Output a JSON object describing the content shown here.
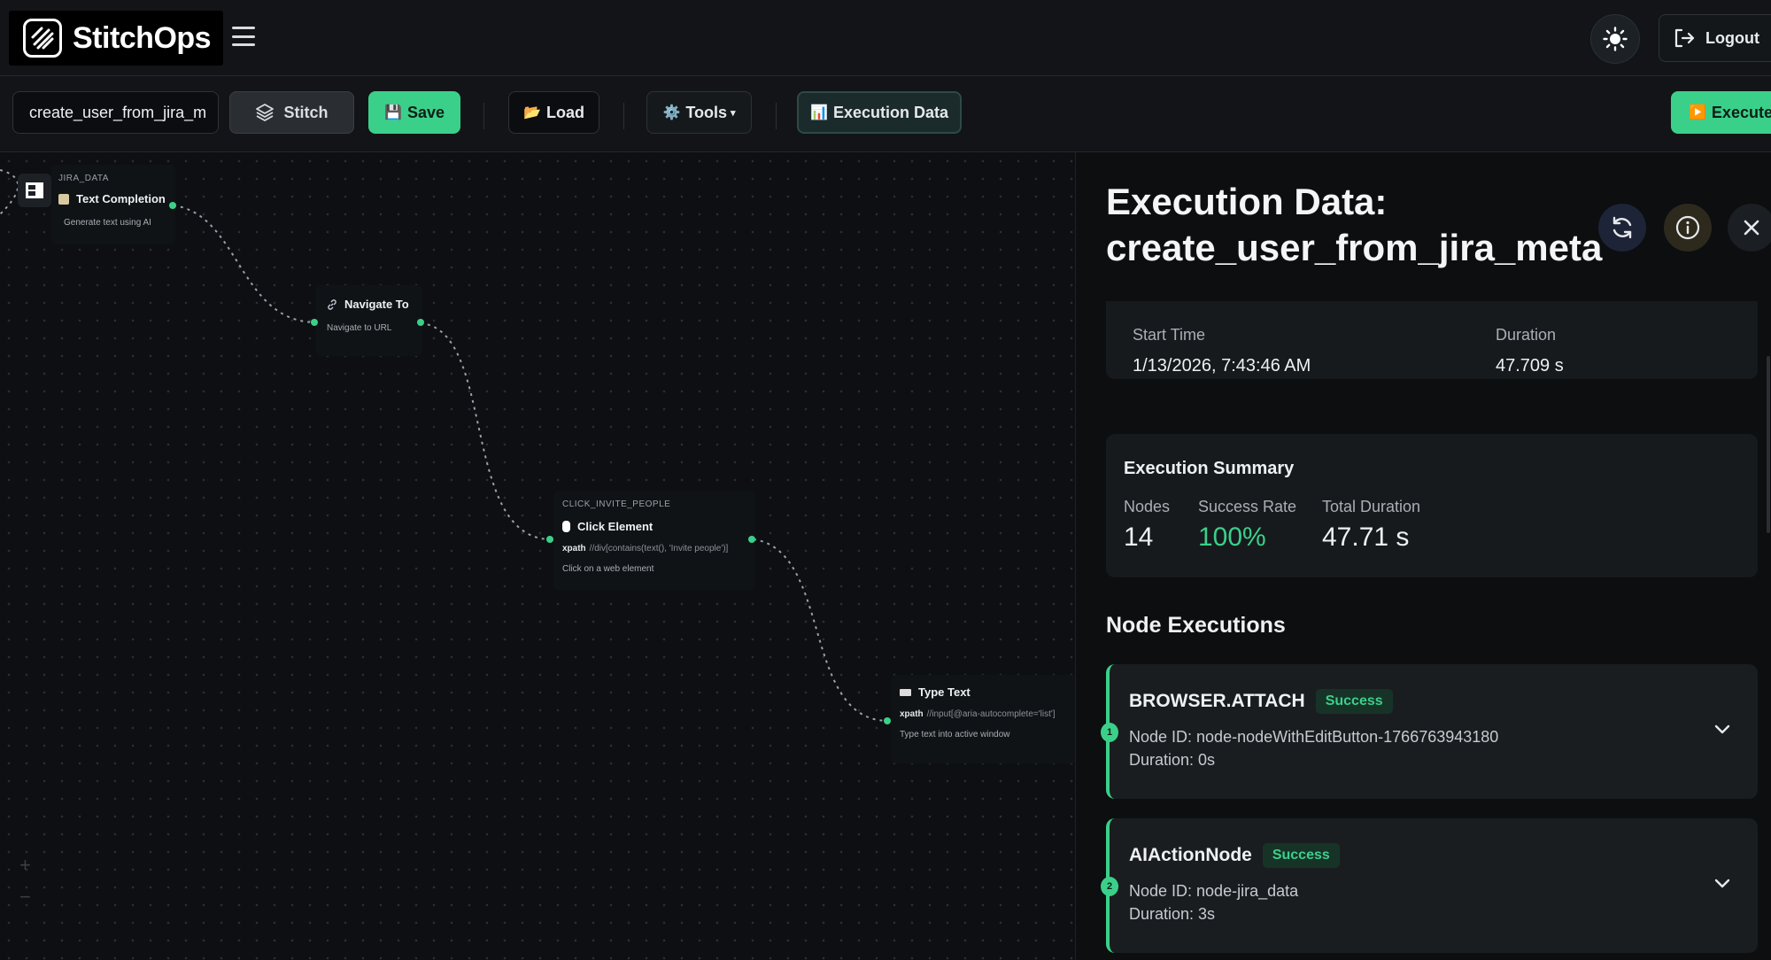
{
  "header": {
    "brand": "StitchOps",
    "logout_label": "Logout"
  },
  "toolbar": {
    "workflow_name": "create_user_from_jira_m",
    "stitch_label": "Stitch",
    "save_label": "Save",
    "load_label": "Load",
    "tools_label": "Tools",
    "execution_data_label": "Execution Data",
    "execute_label": "Execute"
  },
  "canvas": {
    "nodes": [
      {
        "tag": "JIRA_DATA",
        "title": "Text Completion",
        "subtitle": "Generate text using AI"
      },
      {
        "title": "Navigate To",
        "subtitle": "Navigate to URL"
      },
      {
        "tag": "CLICK_INVITE_PEOPLE",
        "title": "Click Element",
        "prop_key": "xpath",
        "prop_val": "//div[contains(text(), 'Invite people')]",
        "subtitle": "Click on a web element"
      },
      {
        "title": "Type Text",
        "prop_key": "xpath",
        "prop_val": "//input[@aria-autocomplete='list']",
        "subtitle": "Type text into active window"
      }
    ]
  },
  "panel": {
    "title": "Execution Data: create_user_from_jira_meta",
    "start_time_label": "Start Time",
    "start_time_value": "1/13/2026, 7:43:46 AM",
    "duration_label": "Duration",
    "duration_value": "47.709 s",
    "summary": {
      "title": "Execution Summary",
      "nodes_label": "Nodes",
      "nodes_value": "14",
      "success_rate_label": "Success Rate",
      "success_rate_value": "100%",
      "total_duration_label": "Total Duration",
      "total_duration_value": "47.71 s"
    },
    "node_executions_title": "Node Executions",
    "executions": [
      {
        "index": "1",
        "name": "BROWSER.ATTACH",
        "status": "Success",
        "node_id": "Node ID: node-nodeWithEditButton-1766763943180",
        "duration": "Duration: 0s"
      },
      {
        "index": "2",
        "name": "AIActionNode",
        "status": "Success",
        "node_id": "Node ID: node-jira_data",
        "duration": "Duration: 3s"
      }
    ]
  },
  "colors": {
    "accent": "#3bd08a",
    "background": "#0e1013",
    "card": "#171a1d"
  }
}
